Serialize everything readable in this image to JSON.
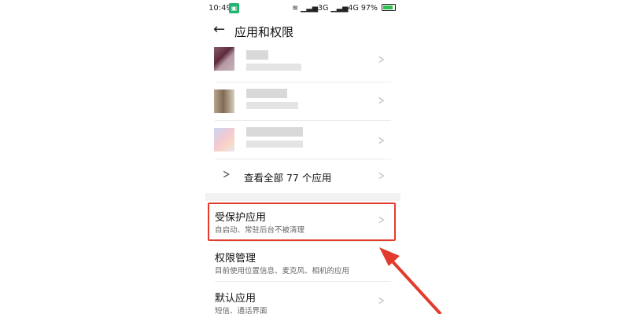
{
  "status_bar": {
    "time": "10:49",
    "signal_3g": "3G",
    "signal_4g": "4G",
    "battery": "97%"
  },
  "header": {
    "title": "应用和权限"
  },
  "apps": [
    {
      "name_redacted": true
    },
    {
      "name_redacted": true
    },
    {
      "name_redacted": true
    }
  ],
  "view_all": {
    "label": "查看全部 77 个应用"
  },
  "settings": [
    {
      "title": "受保护应用",
      "subtitle": "自启动、常驻后台不被清理"
    },
    {
      "title": "权限管理",
      "subtitle": "目前使用位置信息、麦克风、相机的应用"
    },
    {
      "title": "默认应用",
      "subtitle": "短信、通话界面"
    }
  ],
  "colors": {
    "highlight": "#e23b2e",
    "qr_icon": "#21b36f"
  }
}
